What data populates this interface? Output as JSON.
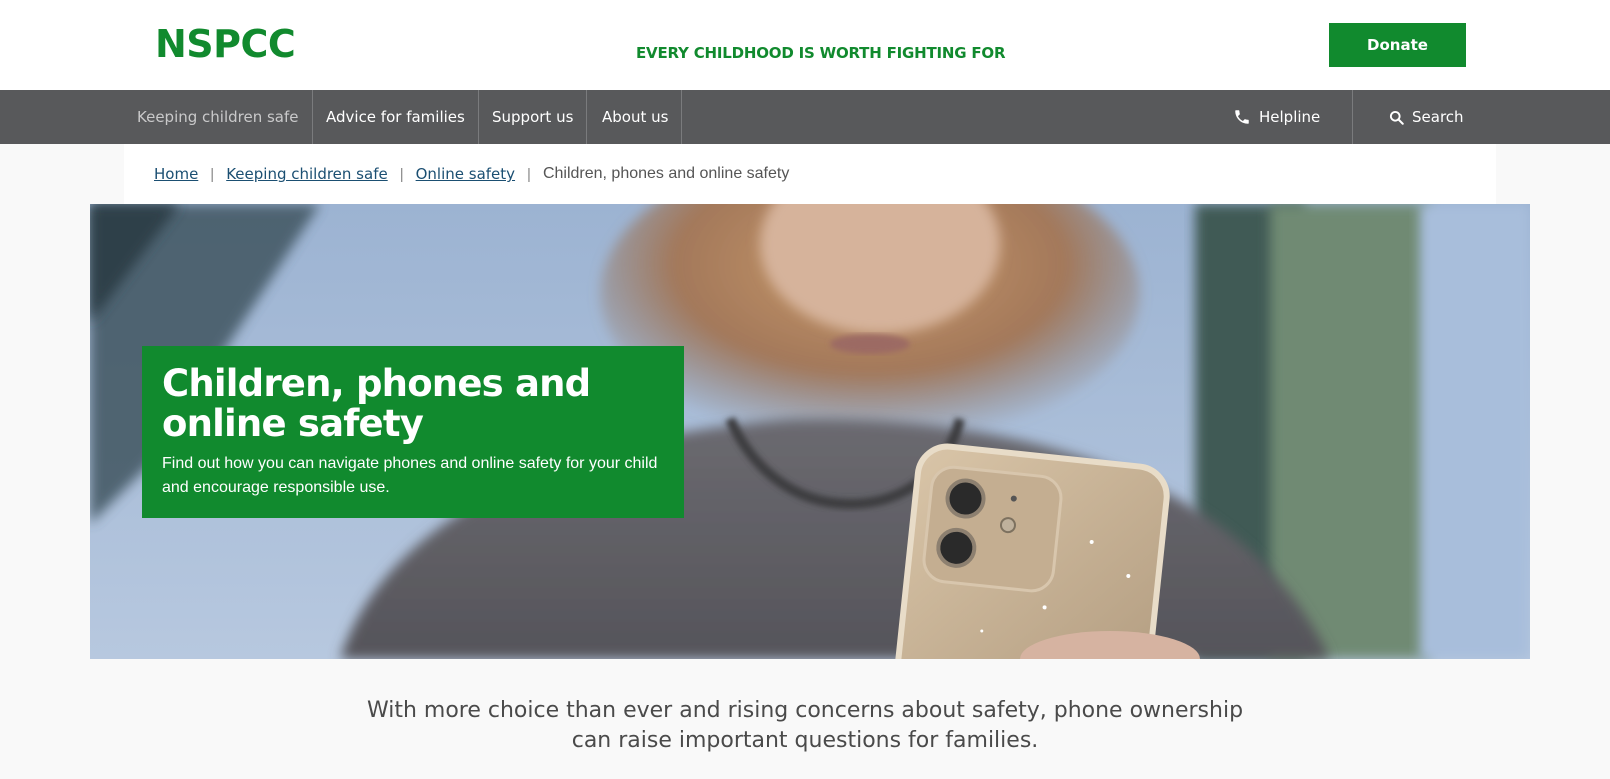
{
  "header": {
    "logo": "NSPCC",
    "tagline": "EVERY CHILDHOOD IS WORTH FIGHTING FOR",
    "donate_label": "Donate"
  },
  "nav": {
    "items": [
      {
        "label": "Keeping children safe"
      },
      {
        "label": "Advice for families"
      },
      {
        "label": "Support us"
      },
      {
        "label": "About us"
      }
    ],
    "helpline_label": "Helpline",
    "search_label": "Search"
  },
  "breadcrumb": {
    "items": [
      {
        "label": "Home"
      },
      {
        "label": "Keeping children safe"
      },
      {
        "label": "Online safety"
      }
    ],
    "current": "Children, phones and online safety"
  },
  "hero": {
    "title": "Children, phones and online safety",
    "subtitle": "Find out how you can navigate phones and online safety for your child and encourage responsible use."
  },
  "intro": {
    "line1": "With more choice than ever and rising concerns about safety, phone ownership",
    "line2": "can raise important questions for families."
  },
  "colors": {
    "brand_green": "#118a2e",
    "nav_grey": "#58595b",
    "link_blue": "#1b4f72"
  },
  "icons": {
    "helpline": "phone-icon",
    "search": "search-icon"
  }
}
